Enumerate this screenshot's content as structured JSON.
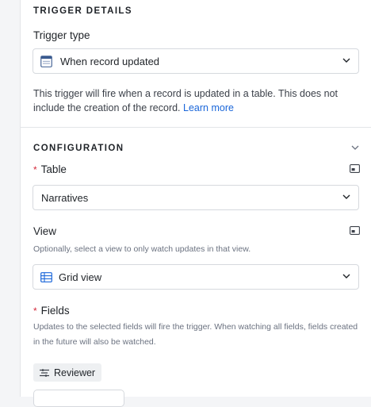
{
  "trigger_details": {
    "section_title": "TRIGGER DETAILS",
    "type_label": "Trigger type",
    "type_value": "When record updated",
    "description": "This trigger will fire when a record is updated in a table. This does not include the creation of the record.",
    "learn_more": "Learn more"
  },
  "configuration": {
    "section_title": "CONFIGURATION",
    "table_label": "Table",
    "table_required": "*",
    "table_value": "Narratives",
    "view_label": "View",
    "view_help": "Optionally, select a view to only watch updates in that view.",
    "view_value": "Grid view",
    "fields_label": "Fields",
    "fields_required": "*",
    "fields_help": "Updates to the selected fields will fire the trigger. When watching all fields, fields created in the future will also be watched.",
    "field_pills": [
      "Reviewer"
    ]
  },
  "icons": {
    "trigger_type": "record-window-icon",
    "view": "grid-view-icon",
    "field": "field-filter-icon",
    "expand_panel": "chevron-down-icon",
    "table_expand": "panel-expand-icon"
  },
  "colors": {
    "link": "#1a66d9",
    "required": "#d4293b",
    "grid_icon": "#1a66d9"
  }
}
